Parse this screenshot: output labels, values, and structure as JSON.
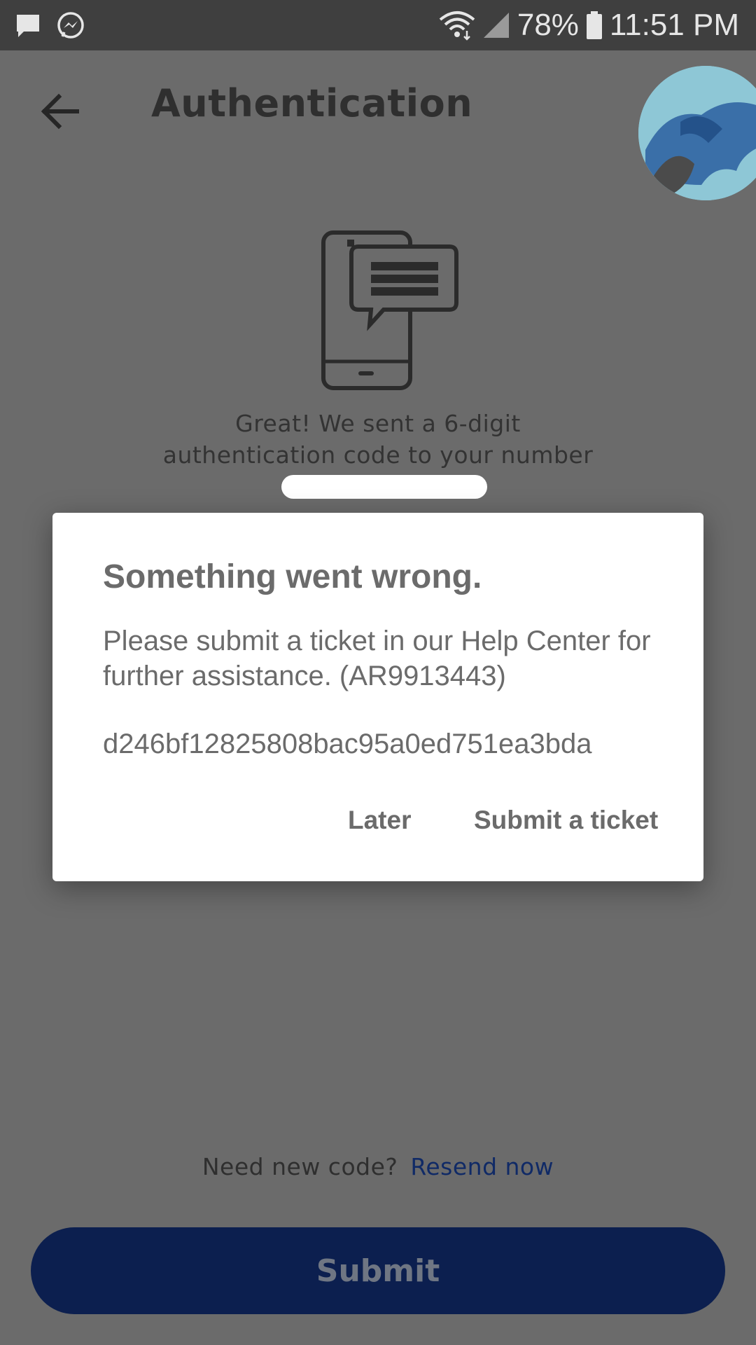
{
  "status_bar": {
    "battery": "78%",
    "time": "11:51 PM",
    "icons": [
      "chat-bubble-icon",
      "messenger-icon",
      "wifi-icon",
      "signal-icon",
      "battery-icon"
    ]
  },
  "header": {
    "title": "Authentication",
    "back_icon": "arrow-left-icon"
  },
  "content": {
    "sent_line1": "Great! We sent a 6-digit",
    "sent_line2": "authentication code to your number",
    "illustration_icon": "phone-message-icon"
  },
  "footer": {
    "need_new_code": "Need new code?",
    "resend": "Resend now",
    "submit": "Submit"
  },
  "dialog": {
    "title": "Something went wrong.",
    "message": "Please submit a ticket in our Help Center for further assistance. (AR9913443)",
    "code": "d246bf12825808bac95a0ed751ea3bda",
    "later": "Later",
    "submit_ticket": "Submit a ticket"
  },
  "colors": {
    "overlay_bg": "#6b6b6b",
    "status_bar_bg": "#3f3f3f",
    "primary_button": "#0c1f4f",
    "link": "#102a66",
    "dialog_bg": "#ffffff"
  }
}
